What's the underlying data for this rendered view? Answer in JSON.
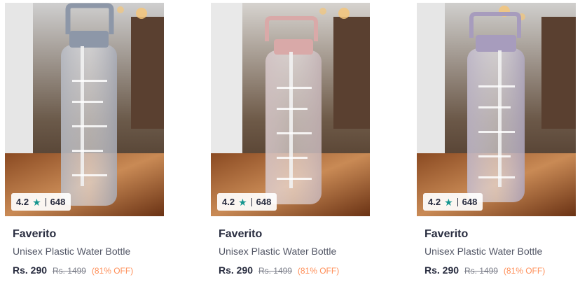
{
  "products": [
    {
      "brand": "Faverito",
      "name": "Unisex Plastic Water Bottle",
      "price": "Rs. 290",
      "mrp": "Rs. 1499",
      "discount": "(81% OFF)",
      "rating": "4.2",
      "rating_count": "648",
      "image": "clear water bottle with grey cap and time markings",
      "cap_color": "#8d97a8"
    },
    {
      "brand": "Faverito",
      "name": "Unisex Plastic Water Bottle",
      "price": "Rs. 290",
      "mrp": "Rs. 1499",
      "discount": "(81% OFF)",
      "rating": "4.2",
      "rating_count": "648",
      "image": "clear water bottle with pink cap and time markings",
      "cap_color": "#d9a9a8"
    },
    {
      "brand": "Faverito",
      "name": "Unisex Plastic Water Bottle",
      "price": "Rs. 290",
      "mrp": "Rs. 1499",
      "discount": "(81% OFF)",
      "rating": "4.2",
      "rating_count": "648",
      "image": "clear water bottle with lavender cap and time markings",
      "cap_color": "#a79cbd"
    }
  ],
  "colors": {
    "star": "#14958f",
    "discount": "#ff905a",
    "text_primary": "#282c3f",
    "text_secondary": "#535766"
  }
}
